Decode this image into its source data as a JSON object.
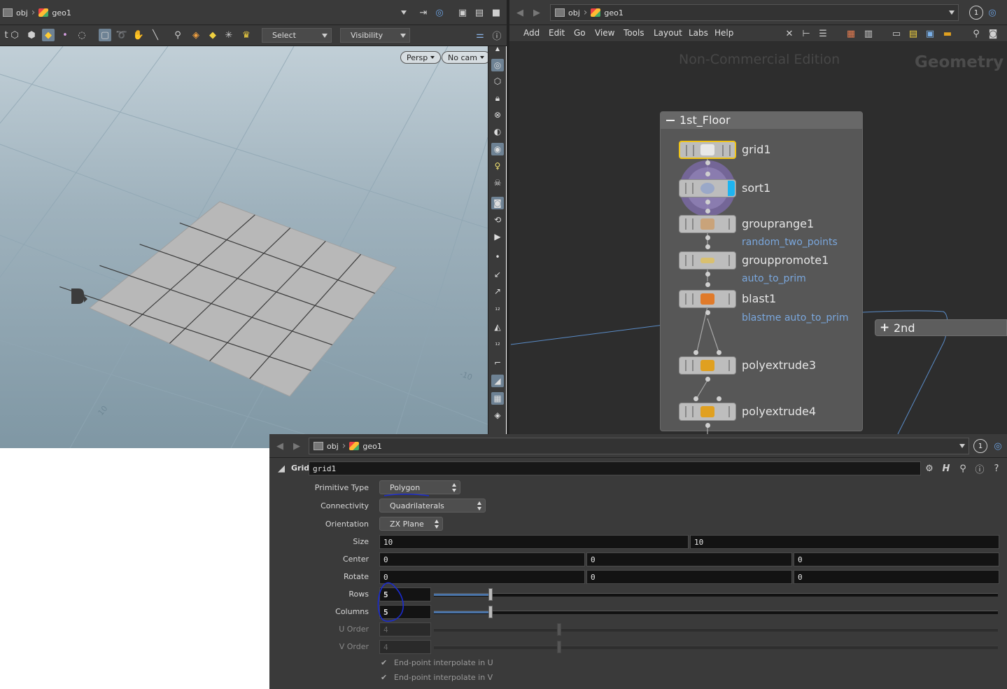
{
  "scene_view": {
    "path": [
      "obj",
      "geo1"
    ],
    "toolbar": {
      "select_mode": "Select",
      "visibility": "Visibility"
    },
    "viewport": {
      "perspective": "Persp",
      "camera": "No cam",
      "grid_labels": [
        "-10",
        "10"
      ]
    }
  },
  "network_view": {
    "path": [
      "obj",
      "geo1"
    ],
    "desktop_number": "1",
    "menu": [
      "Add",
      "Edit",
      "Go",
      "View",
      "Tools",
      "Layout",
      "Labs",
      "Help"
    ],
    "watermark": "Non-Commercial Edition",
    "context": "Geometry",
    "network_box": {
      "title": "1st_Floor"
    },
    "nodes": [
      {
        "name": "grid1",
        "color": "#ffffff"
      },
      {
        "name": "sort1",
        "color": "#9aa8c8"
      },
      {
        "name": "grouprange1",
        "color": "#c9a37a",
        "group": "random_two_points"
      },
      {
        "name": "grouppromote1",
        "color": "#d9c070",
        "group": "auto_to_prim"
      },
      {
        "name": "blast1",
        "color": "#e07a2a",
        "group": "blastme auto_to_prim"
      },
      {
        "name": "polyextrude3",
        "color": "#e0a020"
      },
      {
        "name": "polyextrude4",
        "color": "#e0a020"
      }
    ],
    "collapsed_box": {
      "title": "2nd"
    }
  },
  "parameter_editor": {
    "path": [
      "obj",
      "geo1"
    ],
    "desktop_number": "1",
    "node_type": "Grid",
    "node_name": "grid1",
    "params": {
      "primitive_type": {
        "label": "Primitive Type",
        "value": "Polygon"
      },
      "connectivity": {
        "label": "Connectivity",
        "value": "Quadrilaterals"
      },
      "orientation": {
        "label": "Orientation",
        "value": "ZX Plane"
      },
      "size": {
        "label": "Size",
        "values": [
          "10",
          "10"
        ]
      },
      "center": {
        "label": "Center",
        "values": [
          "0",
          "0",
          "0"
        ]
      },
      "rotate": {
        "label": "Rotate",
        "values": [
          "0",
          "0",
          "0"
        ]
      },
      "rows": {
        "label": "Rows",
        "value": "5",
        "slider_fraction": 0.1
      },
      "columns": {
        "label": "Columns",
        "value": "5",
        "slider_fraction": 0.1
      },
      "u_order": {
        "label": "U Order",
        "value": "4"
      },
      "v_order": {
        "label": "V Order",
        "value": "4"
      },
      "endpoint_u": {
        "label": "End-point interpolate in U",
        "checked": true
      },
      "endpoint_v": {
        "label": "End-point interpolate in V",
        "checked": true
      }
    }
  }
}
